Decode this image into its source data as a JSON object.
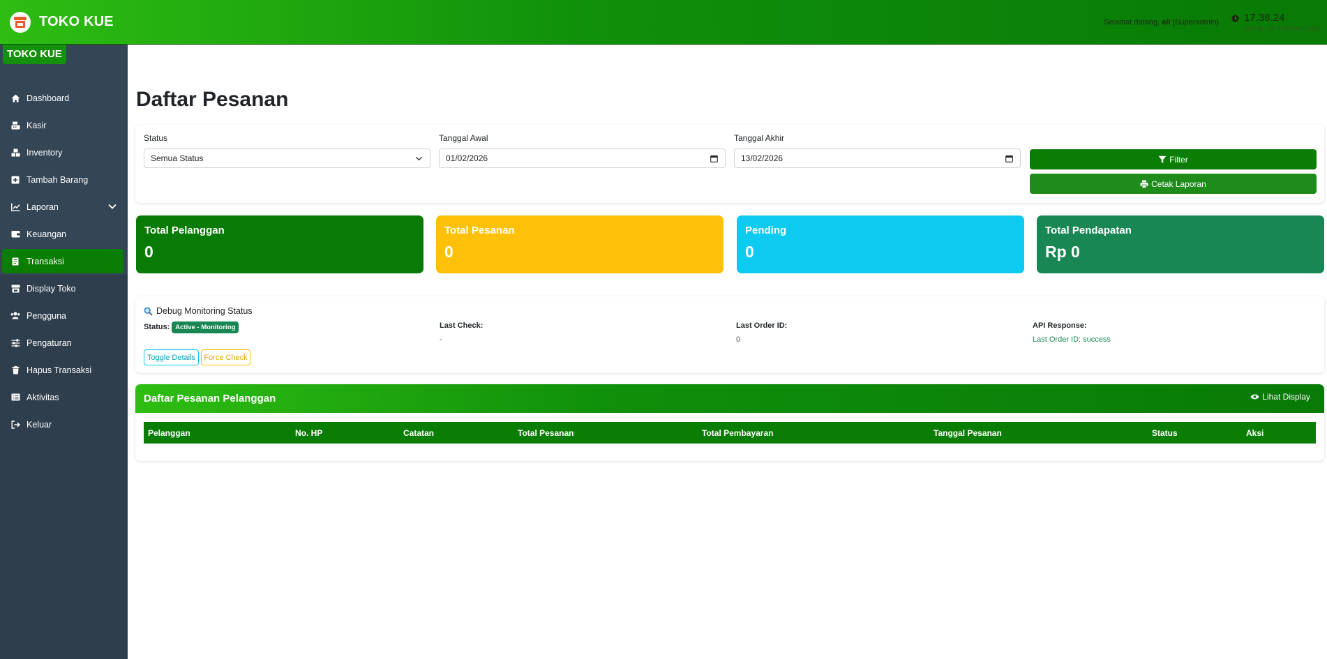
{
  "app": {
    "brand": "TOKO KUE",
    "sidebar_brand": "TOKO KUE"
  },
  "topbar": {
    "welcome_prefix": "Selamat datang, ",
    "user": "ali",
    "role": "(Superadmin)",
    "time": "17.38.24",
    "date": "Jumat, 13 Februari 2026"
  },
  "sidebar": {
    "items": [
      {
        "label": "Dashboard",
        "icon": "home-icon"
      },
      {
        "label": "Kasir",
        "icon": "cash-register-icon"
      },
      {
        "label": "Inventory",
        "icon": "boxes-icon"
      },
      {
        "label": "Tambah Barang",
        "icon": "plus-square-icon"
      },
      {
        "label": "Laporan",
        "icon": "chart-line-icon"
      },
      {
        "label": "Keuangan",
        "icon": "wallet-icon"
      },
      {
        "label": "Transaksi",
        "icon": "receipt-icon"
      },
      {
        "label": "Display Toko",
        "icon": "store-icon"
      },
      {
        "label": "Pengguna",
        "icon": "users-icon"
      },
      {
        "label": "Pengaturan",
        "icon": "sliders-icon"
      },
      {
        "label": "Hapus Transaksi",
        "icon": "trash-icon"
      },
      {
        "label": "Aktivitas",
        "icon": "list-icon"
      },
      {
        "label": "Keluar",
        "icon": "sign-out-icon"
      }
    ],
    "active": "Transaksi"
  },
  "page": {
    "title": "Daftar Pesanan"
  },
  "filter": {
    "status_label": "Status",
    "status_value": "Semua Status",
    "start_label": "Tanggal Awal",
    "start_value": "01/02/2026",
    "end_label": "Tanggal Akhir",
    "end_value": "13/02/2026",
    "filter_button": "Filter",
    "print_button": "Cetak Laporan"
  },
  "stats": [
    {
      "label": "Total Pelanggan",
      "value": "0",
      "color": "#087a06"
    },
    {
      "label": "Total Pesanan",
      "value": "0",
      "color": "#ffc107"
    },
    {
      "label": "Pending",
      "value": "0",
      "color": "#0dcaf0"
    },
    {
      "label": "Total Pendapatan",
      "value": "Rp 0",
      "color": "#198754"
    }
  ],
  "debug": {
    "title": "Debug Monitoring Status",
    "status_label": "Status:",
    "status_badge": "Active - Monitoring",
    "last_check_label": "Last Check:",
    "last_check_value": "-",
    "last_order_label": "Last Order ID:",
    "last_order_value": "0",
    "api_label": "API Response:",
    "api_value": "Last Order ID: success",
    "toggle_button": "Toggle Details",
    "force_button": "Force Check"
  },
  "orders": {
    "title": "Daftar Pesanan Pelanggan",
    "display_button": "Lihat Display",
    "columns": [
      "Pelanggan",
      "No. HP",
      "Catatan",
      "Total Pesanan",
      "Total Pembayaran",
      "Tanggal Pesanan",
      "Status",
      "Aksi"
    ]
  }
}
